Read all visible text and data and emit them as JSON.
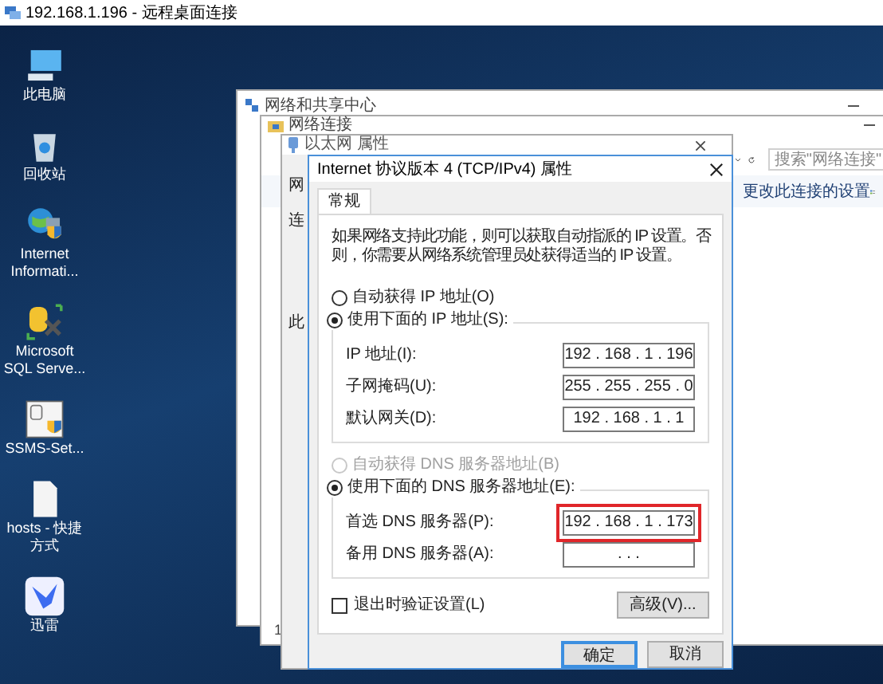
{
  "remote_window": {
    "title": "192.168.1.196 - 远程桌面连接"
  },
  "desktop_icons": [
    {
      "label": "此电脑",
      "kind": "computer"
    },
    {
      "label": "回收站",
      "kind": "bin"
    },
    {
      "label": "Internet Informati...",
      "kind": "globe"
    },
    {
      "label": "Microsoft SQL Serve...",
      "kind": "database"
    },
    {
      "label": "SSMS-Set...",
      "kind": "installer"
    },
    {
      "label": "hosts - 快捷方式",
      "kind": "file"
    },
    {
      "label": "迅雷",
      "kind": "bird"
    }
  ],
  "sharing_center": {
    "title": "网络和共享中心"
  },
  "connections": {
    "title": "网络连接",
    "search": {
      "placeholder": "搜索\"网络连接\""
    },
    "link": "更改此连接的设置",
    "status": "1"
  },
  "ethernet": {
    "title": "以太网 属性",
    "tab": "网",
    "label_1": "连",
    "label_2": "此"
  },
  "dialog": {
    "title": "Internet 协议版本 4 (TCP/IPv4) 属性",
    "tabs": [
      {
        "label": "常规",
        "selected": true
      }
    ],
    "description": "如果网络支持此功能，则可以获取自动指派的 IP 设置。否则，你需要从网络系统管理员处获得适当的 IP 设置。",
    "ip_options": [
      {
        "label": "自动获得 IP 地址(O)",
        "selected": false,
        "disabled": false
      },
      {
        "label": "使用下面的 IP 地址(S):",
        "selected": true,
        "disabled": false
      }
    ],
    "ip_fields": [
      {
        "label": "IP 地址(I):",
        "value": "192 . 168 . 1 . 196",
        "highlighted": false
      },
      {
        "label": "子网掩码(U):",
        "value": "255 . 255 . 255 . 0",
        "highlighted": false
      },
      {
        "label": "默认网关(D):",
        "value": "192 . 168 . 1 . 1",
        "highlighted": false
      }
    ],
    "dns_options": [
      {
        "label": "自动获得 DNS 服务器地址(B)",
        "selected": false,
        "disabled": true
      },
      {
        "label": "使用下面的 DNS 服务器地址(E):",
        "selected": true,
        "disabled": false
      }
    ],
    "dns_fields": [
      {
        "label": "首选 DNS 服务器(P):",
        "value": "192 . 168 . 1 . 173",
        "highlighted": true
      },
      {
        "label": "备用 DNS 服务器(A):",
        "value": ". . .",
        "highlighted": false
      }
    ],
    "validate": {
      "label": "退出时验证设置(L)",
      "checked": false
    },
    "advanced_button": "高级(V)...",
    "buttons": [
      {
        "label": "确定",
        "default": true
      },
      {
        "label": "取消",
        "default": false
      }
    ]
  }
}
